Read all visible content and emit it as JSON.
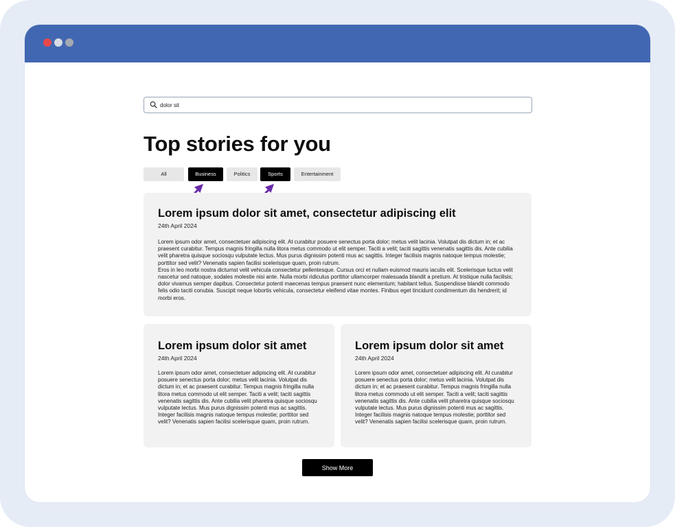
{
  "search": {
    "value": "dolor sit"
  },
  "page_title": "Top stories for you",
  "filters": [
    {
      "label": "All",
      "active": false
    },
    {
      "label": "Business",
      "active": true
    },
    {
      "label": "Politics",
      "active": false
    },
    {
      "label": "Sports",
      "active": true
    },
    {
      "label": "Entertainment",
      "active": false
    }
  ],
  "featured_story": {
    "title": "Lorem ipsum dolor sit amet, consectetur adipiscing elit",
    "date": "24th April 2024",
    "paragraphs": [
      "Lorem ipsum odor amet, consectetuer adipiscing elit. At curabitur posuere senectus porta dolor; metus velit lacinia. Volutpat dis dictum in; et ac praesent curabitur. Tempus magnis fringilla nulla litora metus commodo ut elit semper. Taciti a velit; taciti sagittis venenatis sagittis dis. Ante cubilia velit pharetra quisque sociosqu vulputate lectus. Mus purus dignissim potenti mus ac sagittis. Integer facilisis magnis natoque tempus molestie; porttitor sed velit? Venenatis sapien facilisi scelerisque quam, proin rutrum.",
      "Eros in leo morbi nostra dictumst velit vehicula consectetur pellentesque. Cursus orci et nullam euismod mauris iaculis elit. Scelerisque luctus velit nascetur sed natoque, sodales molestie nisi ante. Nulla morbi ridiculus porttitor ullamcorper malesuada blandit a pretium. At tristique nulla facilisis; dolor vivamus semper dapibus. Consectetur potenti maecenas tempus praesent nunc elementum; habitant tellus. Suspendisse blandit commodo felis odio taciti conubia. Suscipit neque lobortis vehicula, consectetur eleifend vitae montes. Finibus eget tincidunt condimentum dis hendrerit; id morbi eros."
    ]
  },
  "stories": [
    {
      "title": "Lorem ipsum dolor sit amet",
      "date": "24th April 2024",
      "body": "Lorem ipsum odor amet, consectetuer adipiscing elit. At curabitur posuere senectus porta dolor; metus velit lacinia. Volutpat dis dictum in; et ac praesent curabitur. Tempus magnis fringilla nulla litora metus commodo ut elit semper. Taciti a velit; taciti sagittis venenatis sagittis dis. Ante cubilia velit pharetra quisque sociosqu vulputate lectus. Mus purus dignissim potenti mus ac sagittis. Integer facilisis magnis natoque tempus molestie; porttitor sed velit? Venenatis sapien facilisi scelerisque quam, proin rutrum."
    },
    {
      "title": "Lorem ipsum dolor sit amet",
      "date": "24th April 2024",
      "body": "Lorem ipsum odor amet, consectetuer adipiscing elit. At curabitur posuere senectus porta dolor; metus velit lacinia. Volutpat dis dictum in; et ac praesent curabitur. Tempus magnis fringilla nulla litora metus commodo ut elit semper. Taciti a velit; taciti sagittis venenatis sagittis dis. Ante cubilia velit pharetra quisque sociosqu vulputate lectus. Mus purus dignissim potenti mus ac sagittis. Integer facilisis magnis natoque tempus molestie; porttitor sed velit? Venenatis sapien facilisi scelerisque quam, proin rutrum."
    }
  ],
  "show_more_label": "Show More",
  "icons": {
    "search": "search-icon",
    "annotation_arrow": "arrow-up-right-icon"
  },
  "colors": {
    "title_bar": "#4267b2",
    "window_close": "#e8474b",
    "filter_active": "#000000",
    "filter_inactive": "#e7e7e7",
    "card_background": "#f2f2f2",
    "annotation_arrow": "#6a2aa8"
  }
}
